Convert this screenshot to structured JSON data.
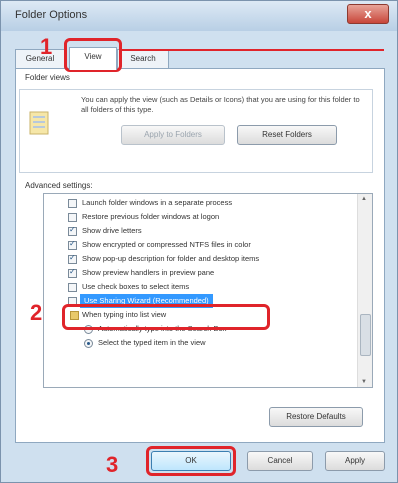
{
  "window": {
    "title": "Folder Options",
    "close_label": "x"
  },
  "tabs": [
    {
      "label": "General"
    },
    {
      "label": "View",
      "active": true
    },
    {
      "label": "Search"
    }
  ],
  "folder_views": {
    "title": "Folder views",
    "description": "You can apply the view (such as Details or Icons) that you are using for this folder to all folders of this type.",
    "apply_button": "Apply to Folders",
    "reset_button": "Reset Folders"
  },
  "advanced": {
    "title": "Advanced settings:",
    "items": [
      {
        "label": "Launch folder windows in a separate process",
        "type": "checkbox",
        "checked": false
      },
      {
        "label": "Restore previous folder windows at logon",
        "type": "checkbox",
        "checked": false
      },
      {
        "label": "Show drive letters",
        "type": "checkbox",
        "checked": true
      },
      {
        "label": "Show encrypted or compressed NTFS files in color",
        "type": "checkbox",
        "checked": true
      },
      {
        "label": "Show pop-up description for folder and desktop items",
        "type": "checkbox",
        "checked": true
      },
      {
        "label": "Show preview handlers in preview pane",
        "type": "checkbox",
        "checked": true
      },
      {
        "label": "Use check boxes to select items",
        "type": "checkbox",
        "checked": false
      },
      {
        "label": "Use Sharing Wizard (Recommended)",
        "type": "checkbox",
        "checked": false,
        "selected": true
      },
      {
        "label": "When typing into list view",
        "type": "group"
      },
      {
        "label": "Automatically type into the Search Box",
        "type": "radio",
        "checked": false
      },
      {
        "label": "Select the typed item in the view",
        "type": "radio",
        "checked": true
      }
    ],
    "restore_button": "Restore Defaults"
  },
  "footer": {
    "ok": "OK",
    "cancel": "Cancel",
    "apply": "Apply"
  },
  "callouts": {
    "one": "1",
    "two": "2",
    "three": "3"
  },
  "colors": {
    "accent": "#e0242a",
    "selection": "#3399ff"
  }
}
